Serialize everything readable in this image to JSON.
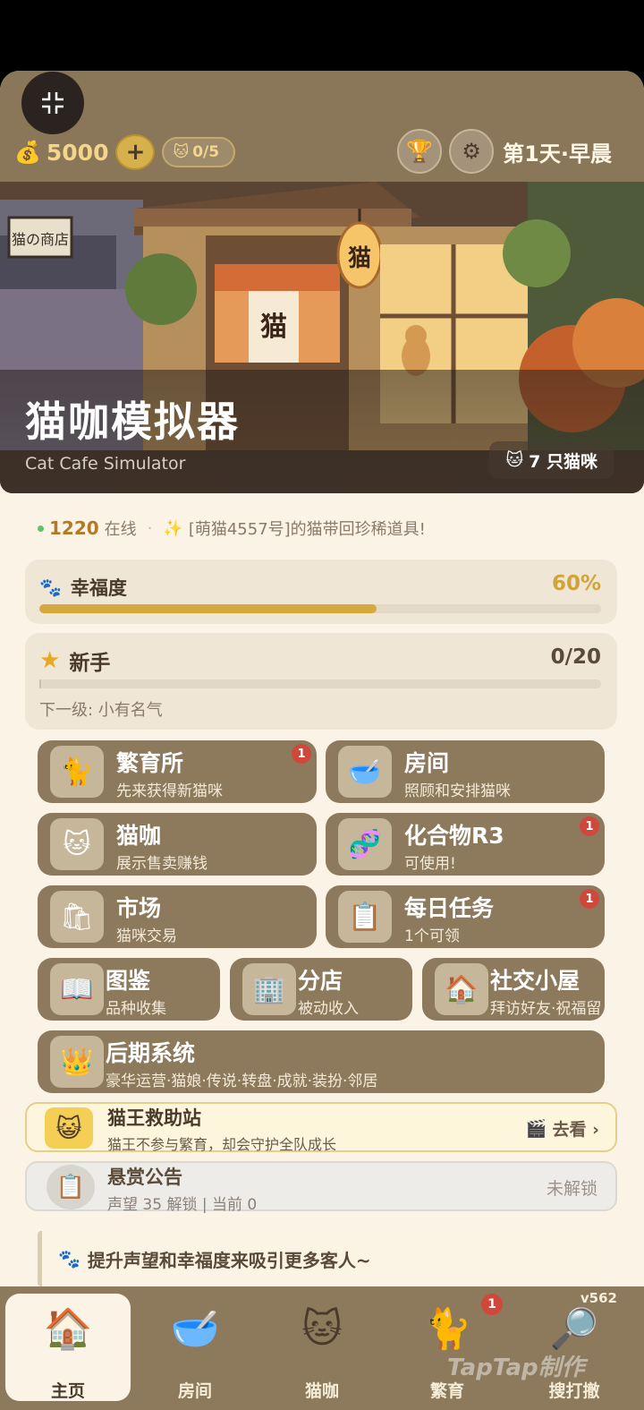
{
  "topbar": {
    "coins": "5000",
    "plus_symbol": "+",
    "cat_capacity": "0/5",
    "day_label": "第1天·早晨",
    "icons": [
      "collapse-icon",
      "trophy-icon",
      "gear-icon"
    ]
  },
  "hero": {
    "title": "猫咖模拟器",
    "subtitle": "Cat Cafe Simulator",
    "cats_badge": "7 只猫咪",
    "sign_char": "猫",
    "shop_sign": "猫の商店"
  },
  "ticker": {
    "online_count": "1220",
    "online_label": "在线",
    "message": "[萌猫4557号]的猫带回珍稀道具!"
  },
  "happiness": {
    "label": "幸福度",
    "value": "60%",
    "fraction": 0.6
  },
  "level": {
    "title": "新手",
    "progress": "0/20",
    "fraction": 0.0,
    "next": "下一级: 小有名气"
  },
  "tiles": [
    {
      "id": "breeding",
      "title": "繁育所",
      "sub": "先来获得新猫咪",
      "badge": "1",
      "icon": "cats-icon"
    },
    {
      "id": "room",
      "title": "房间",
      "sub": "照顾和安排猫咪",
      "badge": "",
      "icon": "bowl-icon"
    },
    {
      "id": "cafe",
      "title": "猫咖",
      "sub": "展示售卖赚钱",
      "badge": "",
      "icon": "cat-face-icon"
    },
    {
      "id": "compound",
      "title": "化合物R3",
      "sub": "可使用!",
      "badge": "1",
      "icon": "dna-icon"
    },
    {
      "id": "market",
      "title": "市场",
      "sub": "猫咪交易",
      "badge": "",
      "icon": "bag-icon"
    },
    {
      "id": "daily",
      "title": "每日任务",
      "sub": "1个可领",
      "badge": "1",
      "icon": "clipboard-icon"
    },
    {
      "id": "catalog",
      "title": "图鉴",
      "sub": "品种收集",
      "badge": "",
      "icon": "book-icon"
    },
    {
      "id": "branch",
      "title": "分店",
      "sub": "被动收入",
      "badge": "",
      "icon": "building-icon"
    },
    {
      "id": "social",
      "title": "社交小屋",
      "sub": "拜访好友·祝福留言",
      "badge": "",
      "icon": "house-icon"
    },
    {
      "id": "late",
      "title": "后期系统",
      "sub": "豪华运营·猫娘·传说·转盘·成就·装扮·邻居",
      "badge": "",
      "icon": "crown-icon"
    }
  ],
  "catking": {
    "title": "猫王救助站",
    "sub": "猫王不参与繁育，却会守护全队成长",
    "action": "去看 ›"
  },
  "bounty": {
    "title": "悬赏公告",
    "sub": "声望 35 解锁 | 当前 0",
    "status": "未解锁"
  },
  "hint": "提升声望和幸福度来吸引更多客人~",
  "nav": {
    "items": [
      {
        "label": "主页",
        "icon": "home-icon"
      },
      {
        "label": "房间",
        "icon": "bowl-icon"
      },
      {
        "label": "猫咖",
        "icon": "cat-face-icon"
      },
      {
        "label": "繁育",
        "icon": "cats-icon",
        "badge": "1"
      },
      {
        "label": "搜打撤",
        "icon": "map-search-icon"
      }
    ],
    "version": "v562",
    "watermark": "TapTap制作"
  },
  "colors": {
    "brown": "#8d7a5d",
    "cream": "#fbf4e6",
    "gold": "#d5a93c",
    "badge_red": "#d0473c"
  }
}
